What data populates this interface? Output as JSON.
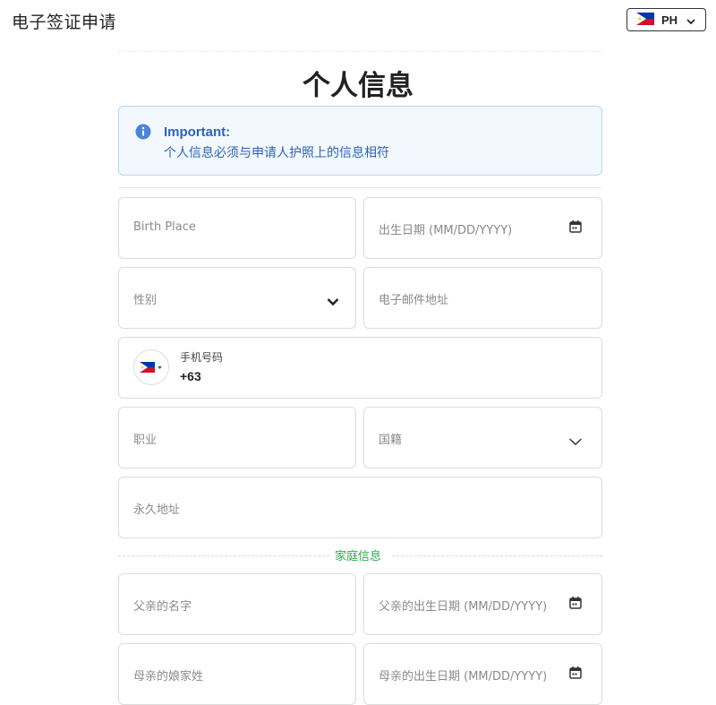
{
  "header": {
    "app_title": "电子签证申请",
    "language_code": "PH",
    "language_flag_icon": "philippines-flag-icon"
  },
  "main": {
    "title": "个人信息",
    "notice": {
      "title": "Important:",
      "message": "个人信息必须与申请人护照上的信息相符",
      "icon": "info-icon",
      "color": "#2d63b8"
    },
    "fields": {
      "birth_place": "Birth Place",
      "birth_date": "出生日期 (MM/DD/YYYY)",
      "gender": "性别",
      "email": "电子邮件地址",
      "phone_label": "手机号码",
      "phone_code": "+63",
      "occupation": "职业",
      "nationality": "国籍",
      "permanent_address": "永久地址"
    },
    "family_section": {
      "label": "家庭信息",
      "color": "#2fa84f",
      "fields": {
        "father_name": "父亲的名字",
        "father_birth_date": "父亲的出生日期 (MM/DD/YYYY)",
        "mother_maiden_name": "母亲的娘家姓",
        "mother_birth_date": "母亲的出生日期 (MM/DD/YYYY)"
      }
    }
  }
}
